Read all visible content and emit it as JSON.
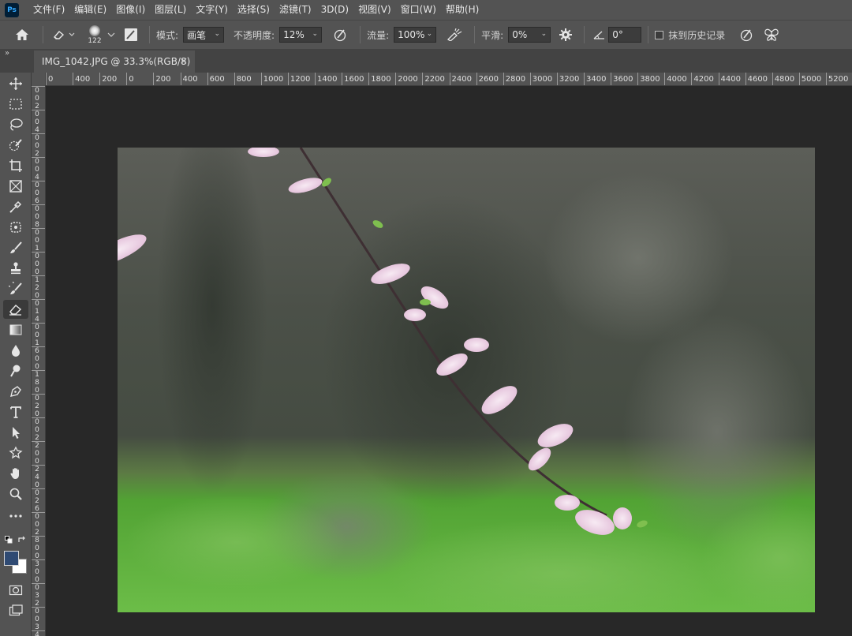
{
  "app": {
    "logo_text": "Ps"
  },
  "menu": [
    "文件(F)",
    "编辑(E)",
    "图像(I)",
    "图层(L)",
    "文字(Y)",
    "选择(S)",
    "滤镜(T)",
    "3D(D)",
    "视图(V)",
    "窗口(W)",
    "帮助(H)"
  ],
  "options": {
    "brush_size": "122",
    "mode_label": "模式:",
    "mode_value": "画笔",
    "opacity_label": "不透明度:",
    "opacity_value": "12%",
    "flow_label": "流量:",
    "flow_value": "100%",
    "smoothing_label": "平滑:",
    "smoothing_value": "0%",
    "angle_value": "0°",
    "erase_history_label": "抹到历史记录"
  },
  "tabs": {
    "collapse_label": "»",
    "document_title": "IMG_1042.JPG @ 33.3%(RGB/8)",
    "close_label": "×"
  },
  "ruler": {
    "h_labels": [
      "0",
      "400",
      "200",
      "0",
      "200",
      "400",
      "600",
      "800",
      "1000",
      "1200",
      "1400",
      "1600",
      "1800",
      "2000",
      "2200",
      "2400",
      "2600",
      "2800",
      "3000",
      "3200",
      "3400",
      "3600",
      "3800",
      "4000",
      "4200",
      "4400",
      "4600",
      "4800",
      "5000",
      "5200",
      "5"
    ],
    "v_labels": [
      "0",
      "0",
      "2",
      "0",
      "0",
      "4",
      "0",
      "0",
      "2",
      "0",
      "0",
      "4",
      "0",
      "0",
      "6",
      "0",
      "0",
      "8",
      "0",
      "0",
      "1",
      "0",
      "0",
      "0",
      "1",
      "2",
      "0",
      "0",
      "1",
      "4",
      "0",
      "0",
      "1",
      "6",
      "0",
      "0",
      "1",
      "8",
      "0",
      "0",
      "2",
      "0",
      "0",
      "0",
      "2",
      "2",
      "0",
      "0",
      "2",
      "4",
      "0",
      "0",
      "2",
      "6",
      "0",
      "0",
      "2",
      "8",
      "0",
      "0",
      "3",
      "0",
      "0",
      "0",
      "3",
      "2",
      "0",
      "0",
      "3",
      "4"
    ]
  },
  "colors": {
    "foreground": "#2f4a73",
    "background": "#ffffff",
    "ui_panel": "#535353",
    "workspace": "#282828"
  }
}
